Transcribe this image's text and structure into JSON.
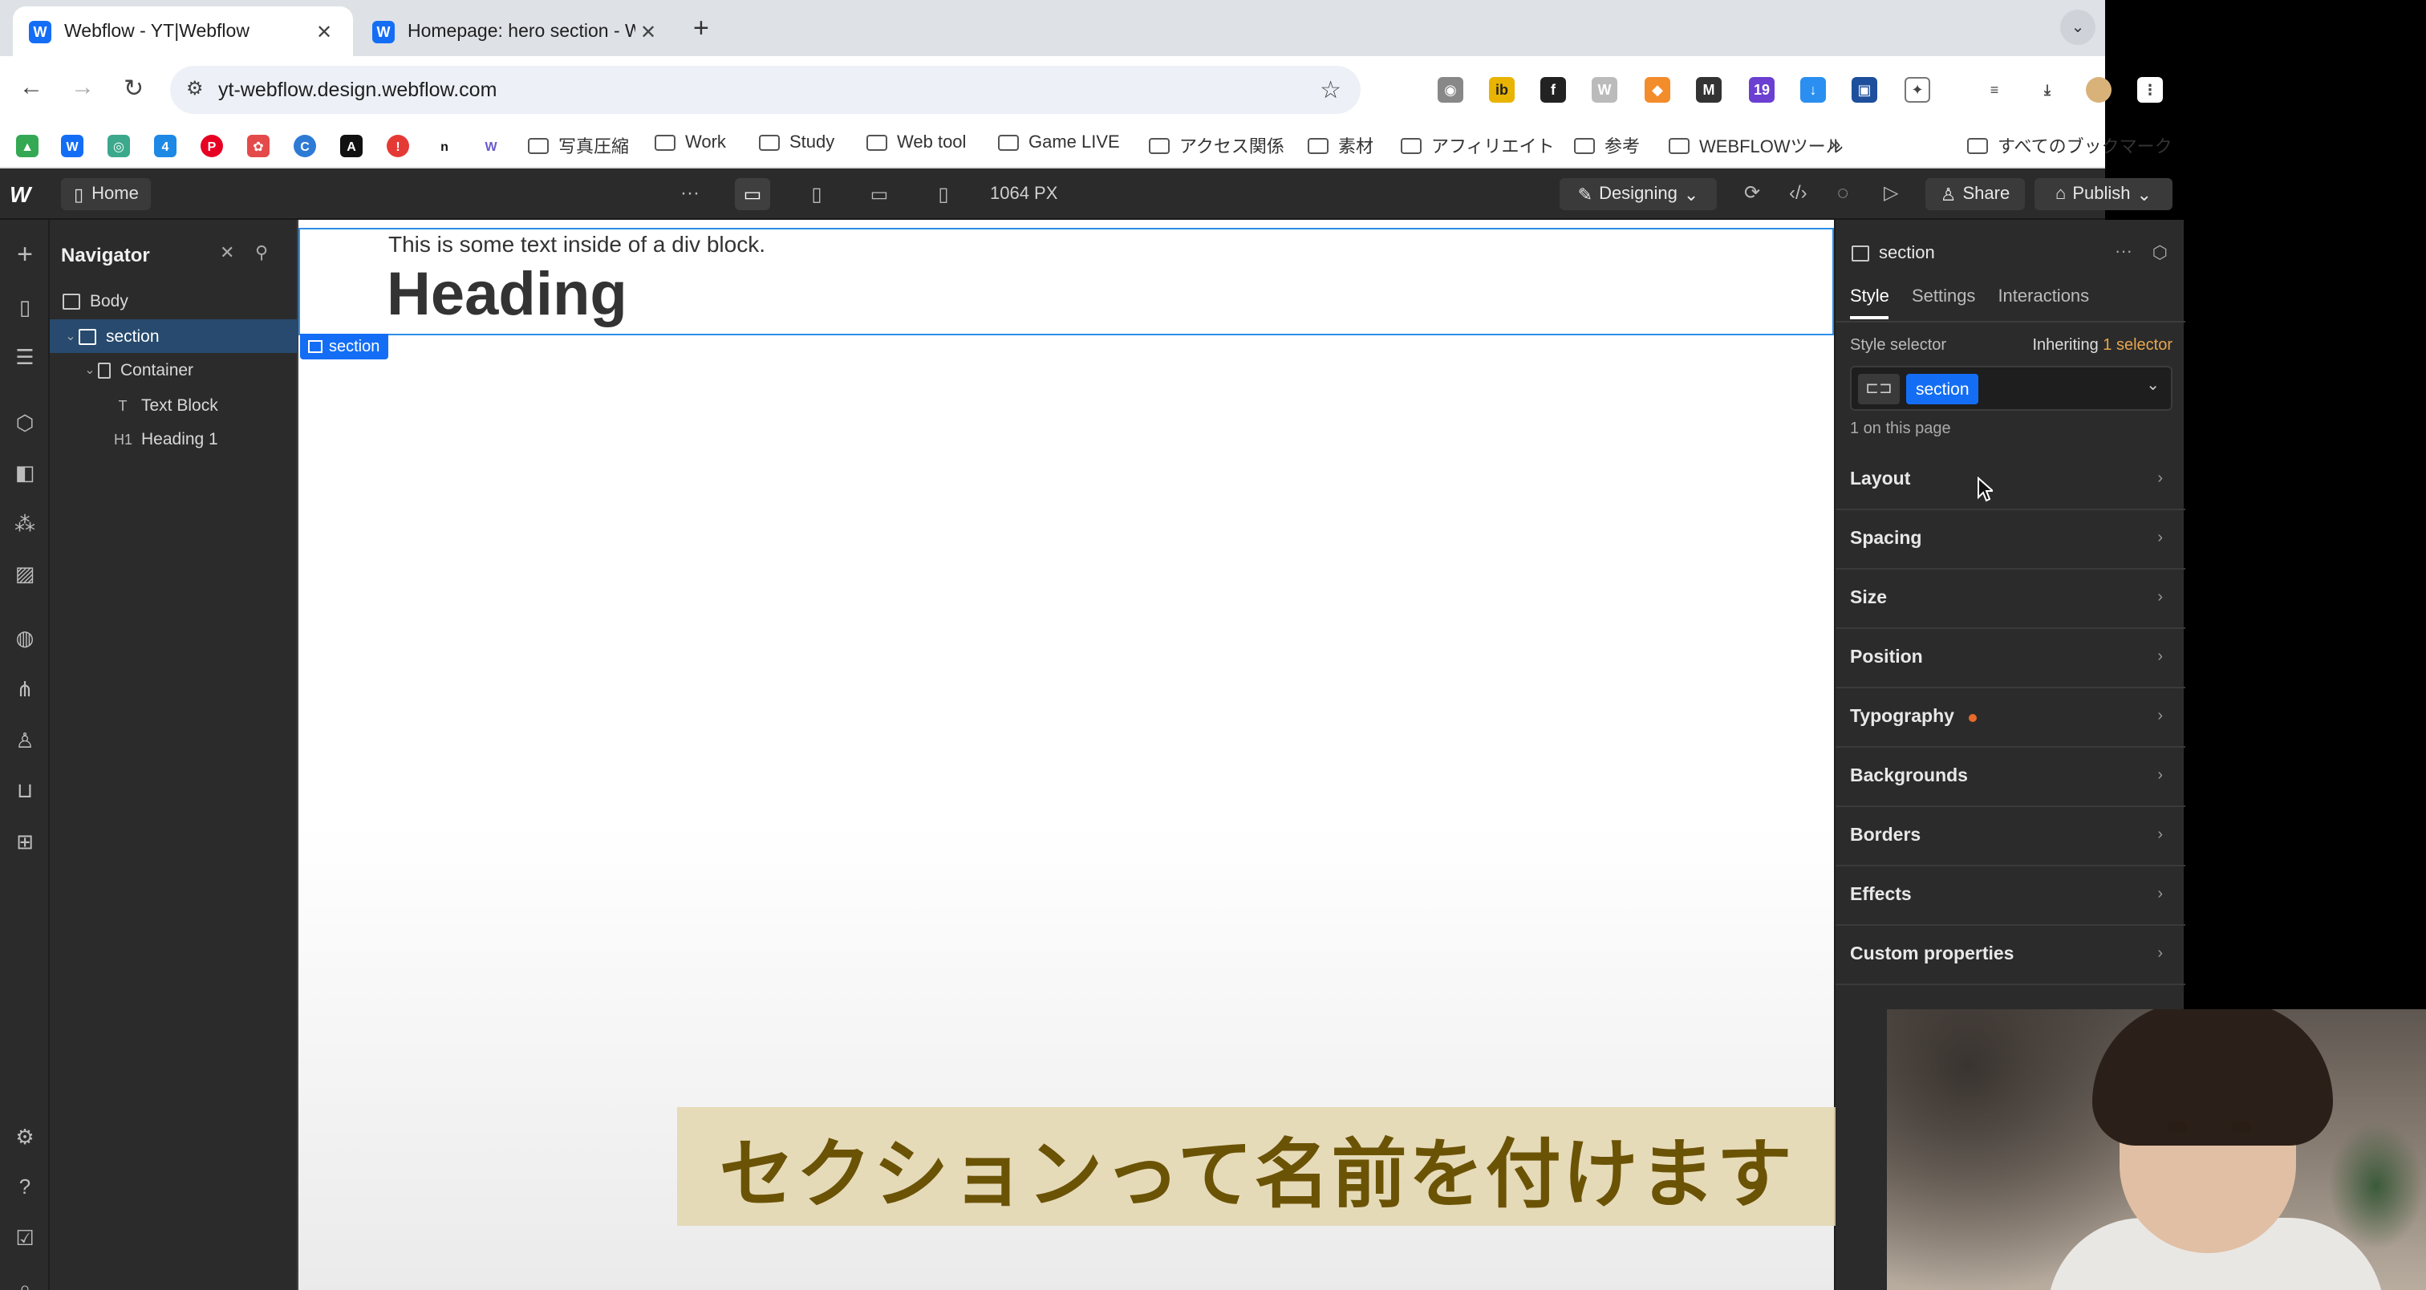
{
  "browser": {
    "tabs": [
      {
        "title": "Webflow - YT|Webflow",
        "favicon": "W",
        "active": true
      },
      {
        "title": "Homepage: hero section - Webflow",
        "favicon": "W",
        "active": false
      }
    ],
    "url": "yt-webflow.design.webflow.com",
    "extension_badge": "19",
    "bookmarks": [
      "写真圧縮",
      "Work",
      "Study",
      "Web tool",
      "Game LIVE",
      "アクセス関係",
      "素材",
      "アフィリエイト",
      "参考",
      "WEBFLOWツール"
    ],
    "all_bookmarks": "すべてのブックマーク"
  },
  "designer": {
    "page": "Home",
    "width_readout": "1064 PX",
    "mode": "Designing",
    "share": "Share",
    "publish": "Publish"
  },
  "navigator": {
    "title": "Navigator",
    "tree": [
      {
        "label": "Body",
        "type": "body",
        "depth": 0
      },
      {
        "label": "section",
        "type": "section",
        "depth": 1,
        "selected": true
      },
      {
        "label": "Container",
        "type": "container",
        "depth": 2
      },
      {
        "label": "Text Block",
        "type": "text",
        "depth": 3
      },
      {
        "label": "Heading 1",
        "type": "h1",
        "depth": 3
      }
    ]
  },
  "canvas": {
    "text_block": "This is some text inside of a div block.",
    "heading": "Heading",
    "selection_label": "section"
  },
  "style_panel": {
    "element_name": "section",
    "tabs": [
      "Style",
      "Settings",
      "Interactions"
    ],
    "selector_label": "Style selector",
    "inheriting_prefix": "Inheriting",
    "inheriting_count": "1",
    "inheriting_suffix": "selector",
    "selector_token": "section",
    "on_page": "1 on this page",
    "sections": [
      "Layout",
      "Spacing",
      "Size",
      "Position",
      "Typography",
      "Backgrounds",
      "Borders",
      "Effects",
      "Custom properties"
    ]
  },
  "subtitle": "セクションって名前を付けます",
  "colors": {
    "accent_blue": "#146ef5",
    "selection_outline": "#2d8fe8",
    "typography_dot": "#e86a2a",
    "subtitle_text": "#6b5306"
  }
}
